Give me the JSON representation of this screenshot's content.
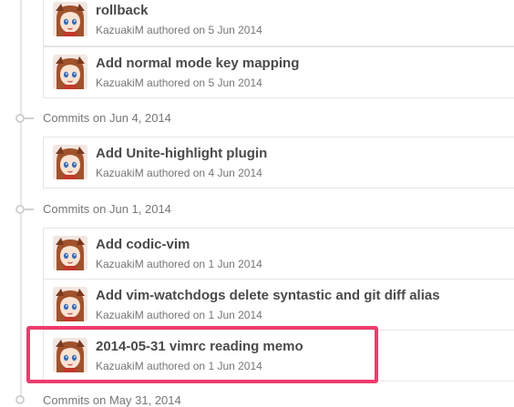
{
  "groups": [
    {
      "header": "",
      "commits": [
        {
          "title": "rollback",
          "author": "KazuakiM",
          "verb": "authored on",
          "date": "5 Jun 2014",
          "avatar_icon": "user-avatar-icon"
        },
        {
          "title": "Add normal mode key mapping",
          "author": "KazuakiM",
          "verb": "authored on",
          "date": "5 Jun 2014",
          "avatar_icon": "user-avatar-icon"
        }
      ]
    },
    {
      "header": "Commits on Jun 4, 2014",
      "commits": [
        {
          "title": "Add Unite-highlight plugin",
          "author": "KazuakiM",
          "verb": "authored on",
          "date": "4 Jun 2014",
          "avatar_icon": "user-avatar-icon"
        }
      ]
    },
    {
      "header": "Commits on Jun 1, 2014",
      "commits": [
        {
          "title": "Add codic-vim",
          "author": "KazuakiM",
          "verb": "authored on",
          "date": "1 Jun 2014",
          "avatar_icon": "user-avatar-icon"
        },
        {
          "title": "Add vim-watchdogs delete syntastic and git diff alias",
          "author": "KazuakiM",
          "verb": "authored on",
          "date": "1 Jun 2014",
          "avatar_icon": "user-avatar-icon"
        },
        {
          "title": "2014-05-31 vimrc reading memo",
          "author": "KazuakiM",
          "verb": "authored on",
          "date": "1 Jun 2014",
          "avatar_icon": "user-avatar-icon",
          "highlighted": true
        }
      ]
    }
  ],
  "clipped_header": "Commits on May 31, 2014",
  "colors": {
    "highlight": "#ee3b6c",
    "title_text": "#4a4a4a",
    "meta_text": "#767676"
  }
}
